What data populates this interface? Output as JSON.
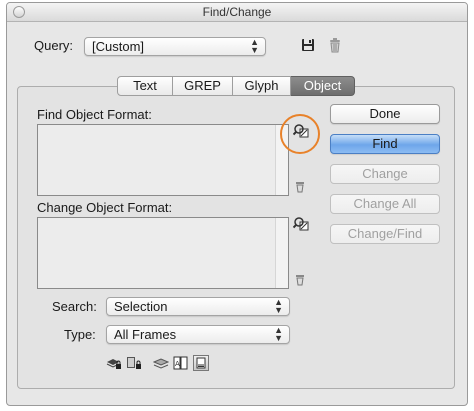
{
  "window": {
    "title": "Find/Change"
  },
  "query": {
    "label": "Query:",
    "value": "[Custom]"
  },
  "tabs": [
    {
      "label": "Text",
      "active": false
    },
    {
      "label": "GREP",
      "active": false
    },
    {
      "label": "Glyph",
      "active": false
    },
    {
      "label": "Object",
      "active": true
    }
  ],
  "find_format": {
    "label": "Find Object Format:"
  },
  "change_format": {
    "label": "Change Object Format:"
  },
  "buttons": {
    "done": "Done",
    "find": "Find",
    "change": "Change",
    "change_all": "Change All",
    "change_find": "Change/Find"
  },
  "search": {
    "label": "Search:",
    "value": "Selection"
  },
  "type": {
    "label": "Type:",
    "value": "All Frames"
  },
  "colors": {
    "highlight": "#e8822a",
    "default_button": "#6ea6ea"
  },
  "icons": [
    "save-query-icon",
    "delete-query-icon",
    "specify-find-format-icon",
    "clear-find-format-icon",
    "specify-change-format-icon",
    "clear-change-format-icon",
    "include-locked-layers-icon",
    "include-locked-objects-icon",
    "include-hidden-layers-icon",
    "include-master-pages-icon",
    "include-footnotes-icon"
  ]
}
